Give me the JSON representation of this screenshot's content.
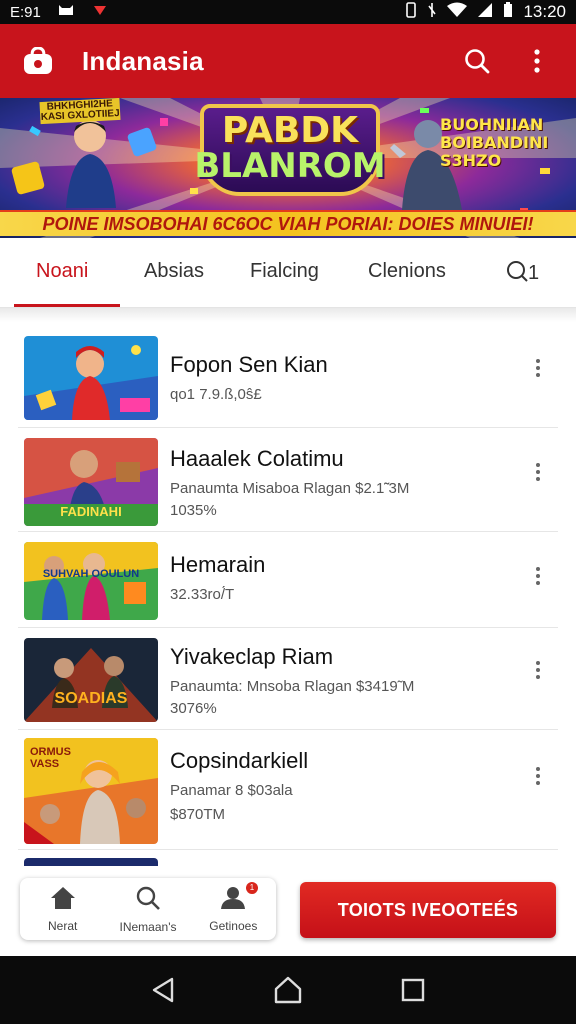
{
  "status_bar": {
    "left_text": "E:91",
    "time": "13:20",
    "icons": [
      "cat-icon",
      "play-triangle-icon",
      "vibrate-icon",
      "no-sim-icon",
      "wifi-icon",
      "signal-icon",
      "battery-icon"
    ]
  },
  "app_bar": {
    "title": "Indanasia",
    "logo_icon": "shop-bag-icon",
    "actions": [
      "search-icon",
      "more-vert-icon"
    ],
    "color": "#c8141c"
  },
  "banner": {
    "corner_text": "BHKHGHI2HE KASI GXLOTIIEJ",
    "logo_line1": "PABDK",
    "logo_line2": "BLANROM",
    "right_text": "BUOHNIIAN BOIBANDINI S3HZO",
    "tagline": "POINE IMSOBOHAI 6C6OC VIAH PORIAI: DOIES MINUIEI!"
  },
  "tabs": {
    "items": [
      "Noani",
      "Absias",
      "Fialcing",
      "Clenions",
      "Q1"
    ],
    "active_index": 0
  },
  "list": [
    {
      "title": "Fopon Sen Kian",
      "subtitle": "qo1 7.9.ß,0ŝ£",
      "subtitle2": "",
      "thumb_text": ""
    },
    {
      "title": "Haaalek Colatimu",
      "subtitle": "Panaumta Misaboa Rlagan $2.1̃̃ 3M",
      "subtitle2": "1035%",
      "thumb_text": "FADINAHI"
    },
    {
      "title": "Hemarain",
      "subtitle": "32.33ro/́Τ",
      "subtitle2": "",
      "thumb_text": "SUHVAH OOULUN"
    },
    {
      "title": "Yivakeclap Riam",
      "subtitle": "Panaumta: Mnsoba Rlagan $3419̃ M",
      "subtitle2": "3076%",
      "thumb_text": "SOADIAS"
    },
    {
      "title": "Copsindarkiell",
      "subtitle": "Panamar 8 $03ala",
      "subtitle2": "$870ΤM",
      "thumb_text": "ORMUS VASS"
    }
  ],
  "bottom_nav": {
    "items": [
      {
        "label": "Nerat",
        "icon": "home-icon"
      },
      {
        "label": "INemaan's",
        "icon": "search-icon"
      },
      {
        "label": "Getinoes",
        "icon": "profile-icon",
        "badge": "1"
      }
    ],
    "cta_label": "TOIOTS IVEOOTEÉS",
    "cta_color": "#c8141c"
  },
  "system_nav": {
    "icons": [
      "back-icon",
      "home-circle-icon",
      "recents-icon"
    ]
  }
}
